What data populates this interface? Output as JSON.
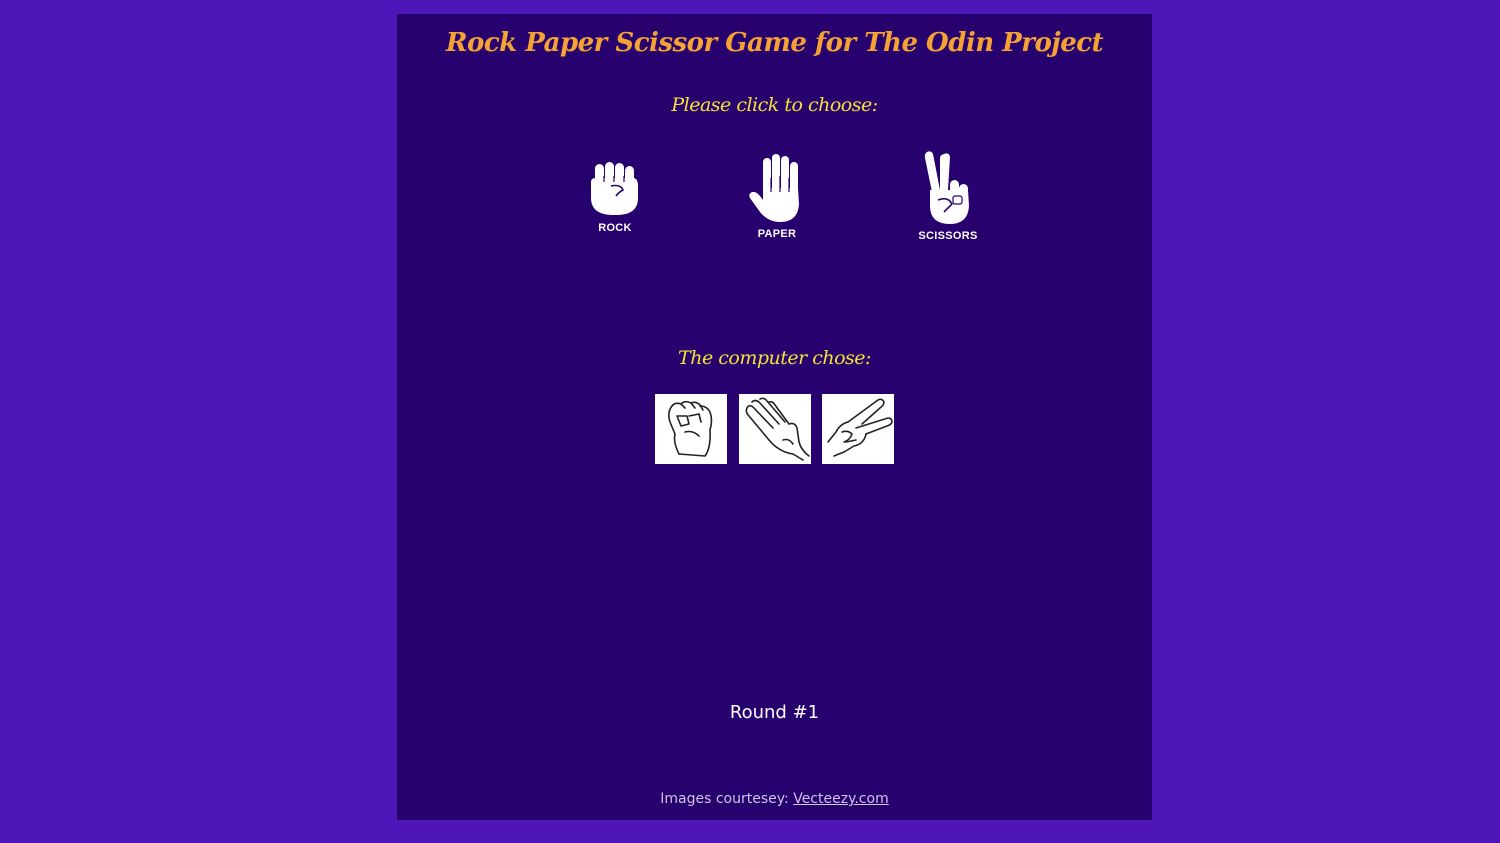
{
  "header": {
    "title": "Rock Paper Scissor Game for The Odin Project"
  },
  "player": {
    "prompt": "Please click to choose:",
    "choices": [
      {
        "label": "ROCK",
        "icon": "rock-hand-icon"
      },
      {
        "label": "PAPER",
        "icon": "paper-hand-icon"
      },
      {
        "label": "SCISSORS",
        "icon": "scissors-hand-icon"
      }
    ]
  },
  "computer": {
    "prompt": "The computer chose:",
    "tiles": [
      {
        "icon": "rock-outline-icon"
      },
      {
        "icon": "paper-outline-icon"
      },
      {
        "icon": "scissors-outline-icon"
      }
    ]
  },
  "status": {
    "round": "Round #1"
  },
  "footer": {
    "credit_prefix": "Images courtesey: ",
    "credit_link": "Vecteezy.com"
  },
  "colors": {
    "page_background": "#4e15b9",
    "panel_background": "#27016e",
    "title": "#f4a234",
    "prompt": "#f3e23a"
  }
}
